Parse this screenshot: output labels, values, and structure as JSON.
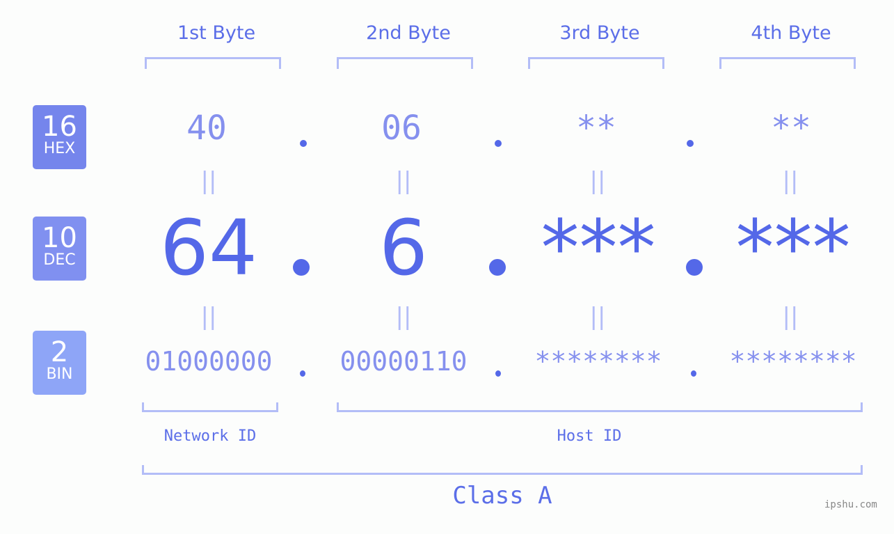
{
  "headers": [
    "1st Byte",
    "2nd Byte",
    "3rd Byte",
    "4th Byte"
  ],
  "badges": [
    {
      "num": "16",
      "label": "HEX",
      "color": "#7585ec"
    },
    {
      "num": "10",
      "label": "DEC",
      "color": "#8090f0"
    },
    {
      "num": "2",
      "label": "BIN",
      "color": "#8ea5f7"
    }
  ],
  "hex": [
    "40",
    "06",
    "**",
    "**"
  ],
  "dec": [
    "64",
    "6",
    "***",
    "***"
  ],
  "bin": [
    "01000000",
    "00000110",
    "********",
    "********"
  ],
  "equals": "||",
  "network_id": "Network ID",
  "host_id": "Host ID",
  "class_label": "Class A",
  "watermark": "ipshu.com"
}
